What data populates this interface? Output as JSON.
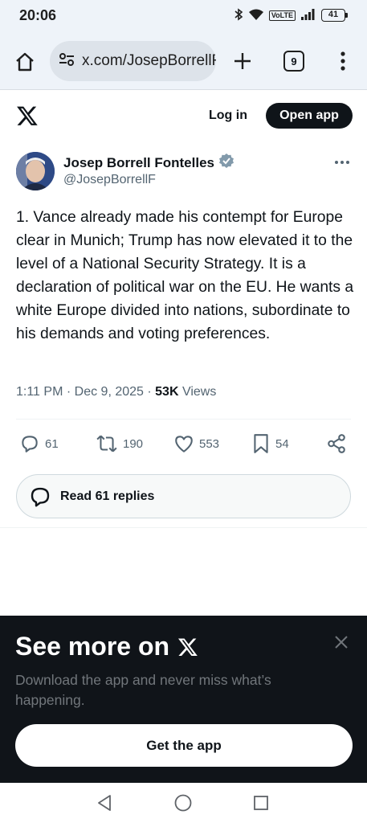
{
  "status_bar": {
    "time": "20:06",
    "network_badge": "VoLTE",
    "battery_level": "41",
    "icons": [
      "bluetooth-icon",
      "wifi-icon",
      "volte-icon",
      "signal-icon",
      "battery-icon"
    ]
  },
  "browser": {
    "url": "x.com/JosepBorrellF",
    "tab_count": "9"
  },
  "x_header": {
    "login_label": "Log in",
    "open_app_label": "Open app"
  },
  "post": {
    "author_name": "Josep Borrell Fontelles",
    "handle": "@JosepBorrellF",
    "text": "1. Vance already made his contempt for Europe clear in Munich; Trump has now elevated it to the level of a National Security Strategy. It is a declaration of political war on the EU. He wants a white Europe divided into nations, subordinate to his demands and voting preferences.",
    "time": "1:11 PM",
    "date": "Dec 9, 2025",
    "separator": "·",
    "views_count": "53K",
    "views_label": "Views",
    "replies": "61",
    "reposts": "190",
    "likes": "553",
    "bookmarks": "54"
  },
  "read_replies_label": "Read 61 replies",
  "promo": {
    "title": "See more on",
    "description": "Download the app and never miss what’s happening.",
    "button_label": "Get the app"
  },
  "colors": {
    "accent_blue": "#1d9bf0",
    "text_primary": "#0f1419",
    "text_secondary": "#536471",
    "promo_background": "#101419"
  }
}
